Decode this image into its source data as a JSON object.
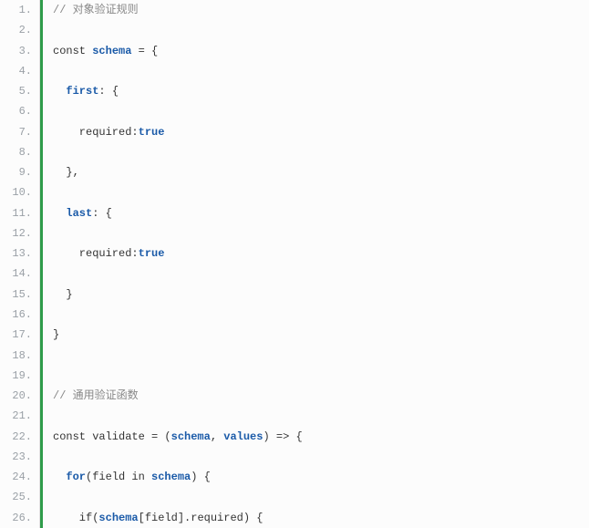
{
  "lines": [
    {
      "n": "1.",
      "segs": [
        {
          "t": "// 对象验证规则",
          "c": "cm"
        }
      ]
    },
    {
      "n": "2.",
      "segs": []
    },
    {
      "n": "3.",
      "segs": [
        {
          "t": "const ",
          "c": ""
        },
        {
          "t": "schema",
          "c": "id"
        },
        {
          "t": " = {",
          "c": ""
        }
      ]
    },
    {
      "n": "4.",
      "segs": []
    },
    {
      "n": "5.",
      "segs": [
        {
          "t": "  ",
          "c": ""
        },
        {
          "t": "first",
          "c": "id"
        },
        {
          "t": ": {",
          "c": ""
        }
      ]
    },
    {
      "n": "6.",
      "segs": []
    },
    {
      "n": "7.",
      "segs": [
        {
          "t": "    required:",
          "c": ""
        },
        {
          "t": "true",
          "c": "lit"
        }
      ]
    },
    {
      "n": "8.",
      "segs": []
    },
    {
      "n": "9.",
      "segs": [
        {
          "t": "  },",
          "c": ""
        }
      ]
    },
    {
      "n": "10.",
      "segs": []
    },
    {
      "n": "11.",
      "segs": [
        {
          "t": "  ",
          "c": ""
        },
        {
          "t": "last",
          "c": "id"
        },
        {
          "t": ": {",
          "c": ""
        }
      ]
    },
    {
      "n": "12.",
      "segs": []
    },
    {
      "n": "13.",
      "segs": [
        {
          "t": "    required:",
          "c": ""
        },
        {
          "t": "true",
          "c": "lit"
        }
      ]
    },
    {
      "n": "14.",
      "segs": []
    },
    {
      "n": "15.",
      "segs": [
        {
          "t": "  }",
          "c": ""
        }
      ]
    },
    {
      "n": "16.",
      "segs": []
    },
    {
      "n": "17.",
      "segs": [
        {
          "t": "}",
          "c": ""
        }
      ]
    },
    {
      "n": "18.",
      "segs": []
    },
    {
      "n": "19.",
      "segs": []
    },
    {
      "n": "20.",
      "segs": [
        {
          "t": "// 通用验证函数",
          "c": "cm"
        }
      ]
    },
    {
      "n": "21.",
      "segs": []
    },
    {
      "n": "22.",
      "segs": [
        {
          "t": "const validate = (",
          "c": ""
        },
        {
          "t": "schema",
          "c": "id"
        },
        {
          "t": ", ",
          "c": ""
        },
        {
          "t": "values",
          "c": "id"
        },
        {
          "t": ") => {",
          "c": ""
        }
      ]
    },
    {
      "n": "23.",
      "segs": []
    },
    {
      "n": "24.",
      "segs": [
        {
          "t": "  ",
          "c": ""
        },
        {
          "t": "for",
          "c": "kw"
        },
        {
          "t": "(field in ",
          "c": ""
        },
        {
          "t": "schema",
          "c": "id"
        },
        {
          "t": ") {",
          "c": ""
        }
      ]
    },
    {
      "n": "25.",
      "segs": []
    },
    {
      "n": "26.",
      "segs": [
        {
          "t": "    if(",
          "c": ""
        },
        {
          "t": "schema",
          "c": "id"
        },
        {
          "t": "[field].required) {",
          "c": ""
        }
      ]
    }
  ]
}
